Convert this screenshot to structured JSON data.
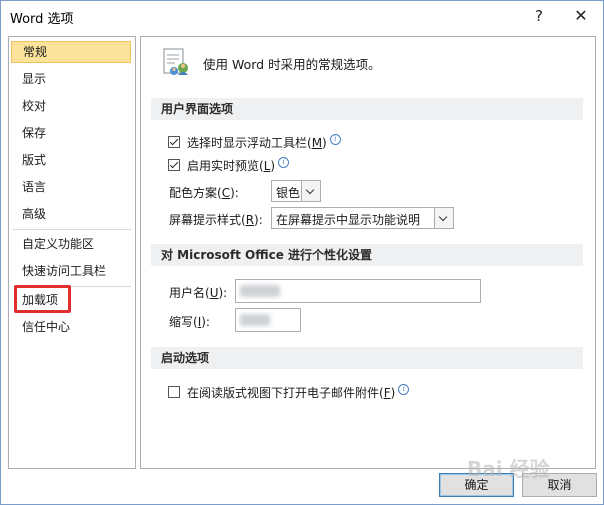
{
  "window": {
    "title": "Word 选项",
    "help_glyph": "?",
    "close_glyph": "✕"
  },
  "sidebar": {
    "items": [
      {
        "label": "常规",
        "selected": true
      },
      {
        "label": "显示"
      },
      {
        "label": "校对"
      },
      {
        "label": "保存"
      },
      {
        "label": "版式"
      },
      {
        "label": "语言"
      },
      {
        "label": "高级"
      },
      {
        "label": "自定义功能区"
      },
      {
        "label": "快速访问工具栏"
      },
      {
        "label": "加载项",
        "highlighted": true
      },
      {
        "label": "信任中心"
      }
    ]
  },
  "content": {
    "heading": "使用 Word 时采用的常规选项。",
    "ui_section": {
      "title": "用户界面选项",
      "show_mini_toolbar": {
        "label": "选择时显示浮动工具栏(",
        "key": "M",
        "suffix": ")",
        "checked": true
      },
      "live_preview": {
        "label": "启用实时预览(",
        "key": "L",
        "suffix": ")",
        "checked": true
      },
      "color_scheme": {
        "label": "配色方案(",
        "key": "C",
        "suffix": "):",
        "value": "银色"
      },
      "screentip_style": {
        "label": "屏幕提示样式(",
        "key": "R",
        "suffix": "):",
        "value": "在屏幕提示中显示功能说明"
      }
    },
    "personalize_section": {
      "title": "对 Microsoft Office 进行个性化设置",
      "username": {
        "label": "用户名(",
        "key": "U",
        "suffix": "):"
      },
      "initials": {
        "label": "缩写(",
        "key": "I",
        "suffix": "):"
      }
    },
    "startup_section": {
      "title": "启动选项",
      "reading_view": {
        "label": "在阅读版式视图下打开电子邮件附件(",
        "key": "F",
        "suffix": ")",
        "checked": false
      }
    }
  },
  "footer": {
    "ok_label": "确定",
    "cancel_label": "取消"
  },
  "watermark": "Bai 经验",
  "colors": {
    "selected_bg": "#fbe39b",
    "highlight_border": "#e02d2d",
    "section_bg": "#eff0f2",
    "info_icon": "#4a7fc4"
  }
}
